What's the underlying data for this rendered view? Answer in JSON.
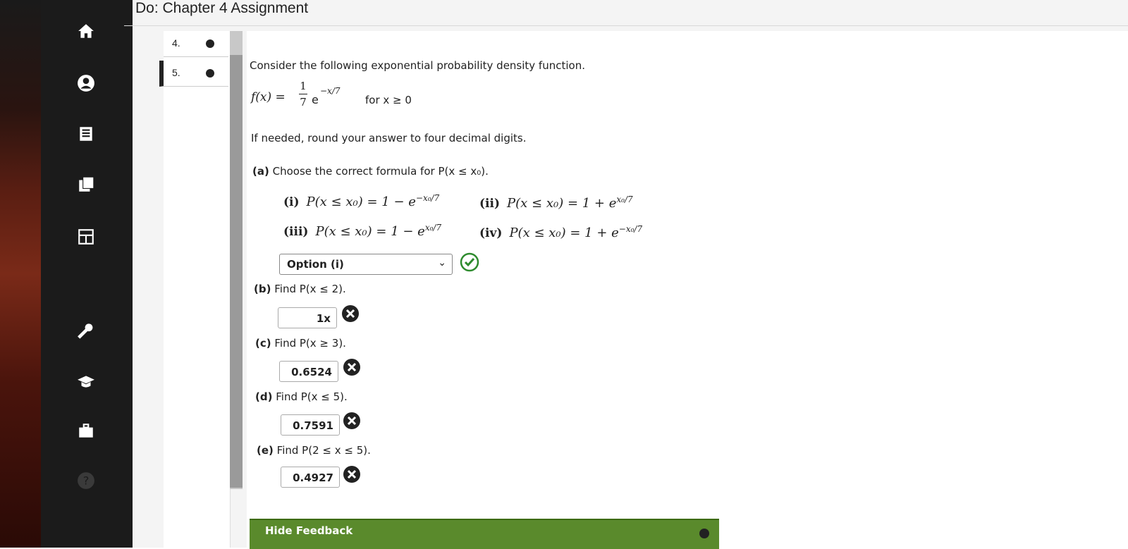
{
  "header": {
    "title": "Do: Chapter 4 Assignment"
  },
  "nav_rail": {
    "icons": [
      "home-icon",
      "user-icon",
      "notebook-icon",
      "cards-icon",
      "calculator-icon",
      "wrench-icon",
      "graduation-cap-icon",
      "briefcase-icon",
      "help-icon"
    ],
    "help_glyph": "?"
  },
  "question_list": [
    {
      "number": "4.",
      "status": "completed"
    },
    {
      "number": "5.",
      "status": "completed",
      "active": true
    }
  ],
  "question": {
    "intro": "Consider the following exponential probability density function.",
    "func_lhs": "f(x) =",
    "frac_num": "1",
    "frac_den": "7",
    "func_exp_base": "e",
    "func_exp": "−x/7",
    "func_domain": "for x ≥ 0",
    "rounding": "If needed, round your answer to four decimal digits.",
    "part_a": {
      "label": "(a)",
      "text": "Choose the correct formula for P(x ≤ x₀)."
    },
    "options": [
      {
        "roman": "(i)",
        "lhs": "P(x ≤ x₀) = 1 − e",
        "exp": "−x₀/7"
      },
      {
        "roman": "(ii)",
        "lhs": "P(x ≤ x₀) = 1 + e",
        "exp": "x₀/7"
      },
      {
        "roman": "(iii)",
        "lhs": "P(x ≤ x₀) = 1 − e",
        "exp": "x₀/7"
      },
      {
        "roman": "(iv)",
        "lhs": "P(x ≤ x₀) = 1 + e",
        "exp": "−x₀/7"
      }
    ],
    "selected_option": "Option (i)",
    "part_b": {
      "label": "(b)",
      "text": "Find P(x ≤ 2).",
      "answer": "1x"
    },
    "part_c": {
      "label": "(c)",
      "text": "Find P(x ≥ 3).",
      "answer": "0.6524"
    },
    "part_d": {
      "label": "(d)",
      "text": "Find P(x ≤ 5).",
      "answer": "0.7591"
    },
    "part_e": {
      "label": "(e)",
      "text": "Find P(2 ≤ x ≤ 5).",
      "answer": "0.4927"
    }
  },
  "feedback": {
    "label": "Hide Feedback"
  },
  "colors": {
    "correct": "#2e8b2e",
    "incorrect": "#222222",
    "feedback_bar": "#5a8a2c"
  }
}
